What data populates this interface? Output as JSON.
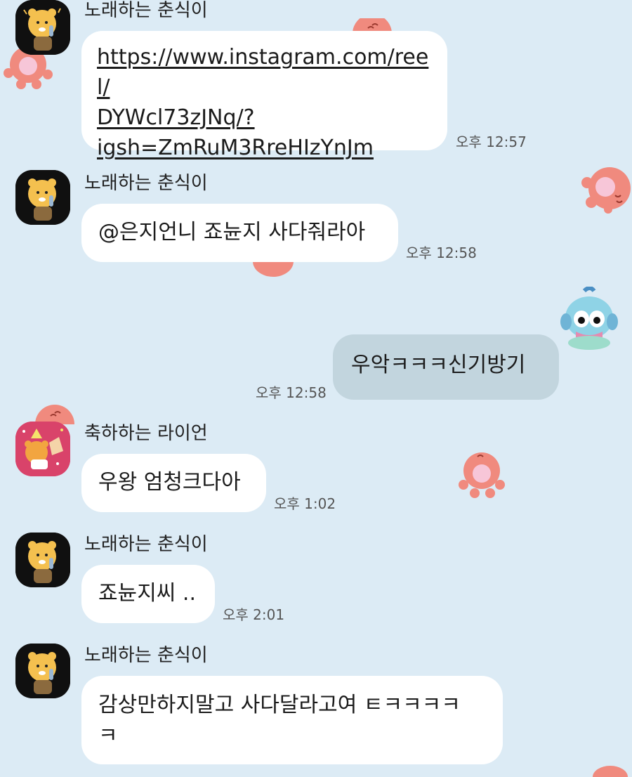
{
  "messages": [
    {
      "sender": "노래하는 춘식이",
      "avatar_icon": "singing-chunsik-avatar-icon",
      "text": "https://www.instagram.com/reel/DYWcl73zJNq/?igsh=ZmRuM3RreHIzYnJm",
      "link_lines": [
        "https://www.instagram.com/reel/",
        "DYWcl73zJNq/?",
        "igsh=ZmRuM3RreHIzYnJm"
      ],
      "time": "오후 12:57",
      "is_link": true
    },
    {
      "sender": "노래하는 춘식이",
      "avatar_icon": "singing-chunsik-avatar-icon",
      "text": "@은지언니 죠뉸지 사다줘라아",
      "time": "오후 12:58"
    },
    {
      "sender": "me",
      "avatar_icon": "hangyodon-sticker-icon",
      "text": "우악ㅋㅋㅋ신기방기",
      "time": "오후 12:58",
      "mine": true
    },
    {
      "sender": "축하하는 라이언",
      "avatar_icon": "celebrating-ryan-avatar-icon",
      "text": "우왕 엄청크다아",
      "time": "오후 1:02"
    },
    {
      "sender": "노래하는 춘식이",
      "avatar_icon": "singing-chunsik-avatar-icon",
      "text": "죠뉸지씨 ..",
      "time": "오후 2:01"
    },
    {
      "sender": "노래하는 춘식이",
      "avatar_icon": "singing-chunsik-avatar-icon",
      "text_lines": [
        "감상만하지말고 사다달라고여 ㅌㅋㅋㅋㅋ",
        "ㅋ"
      ],
      "time": ""
    }
  ],
  "colors": {
    "background": "#DCEBF5",
    "bubble_other": "#FFFFFF",
    "bubble_mine": "#C2D5DE",
    "octopus_decoration": "#F08A7E"
  },
  "decorations": [
    "octopus-wallpaper-icon"
  ]
}
